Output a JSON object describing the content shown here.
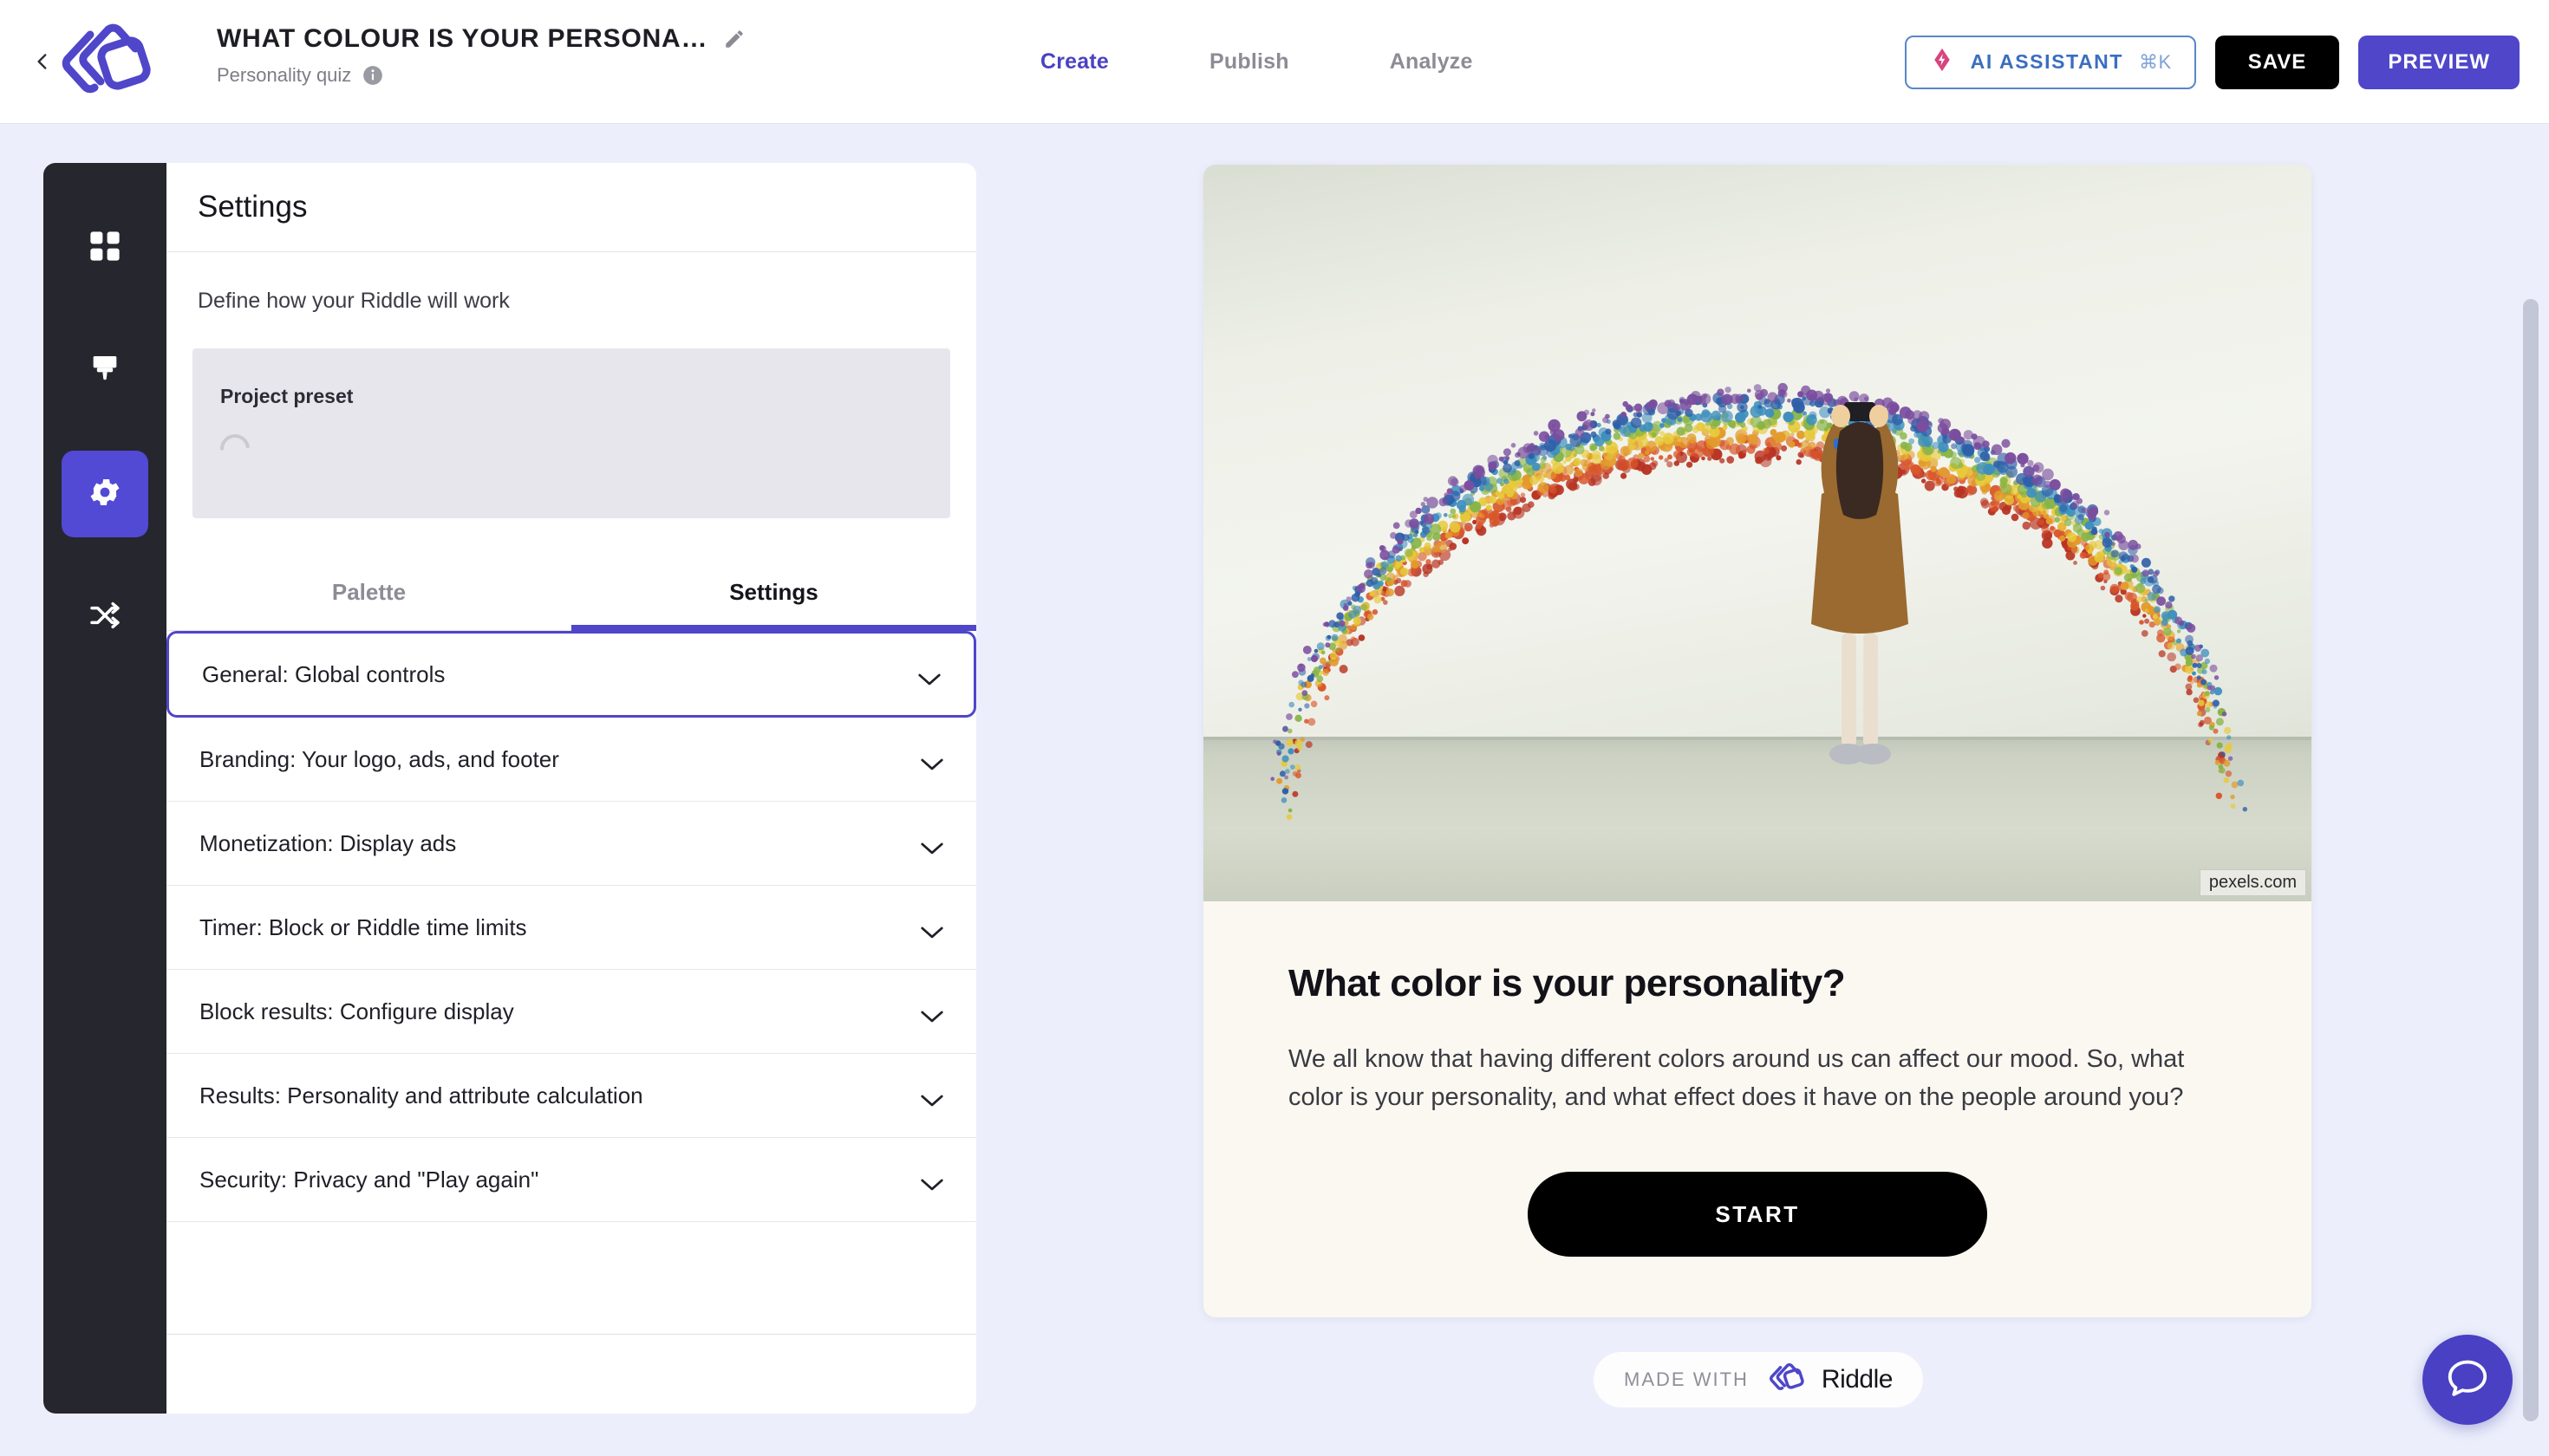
{
  "header": {
    "back_icon": "chevron-left-icon",
    "logo": "riddle-logo",
    "project_title": "WHAT COLOUR IS YOUR PERSONA…",
    "edit_icon": "pencil-icon",
    "project_subtitle": "Personality quiz",
    "info_icon": "info-icon",
    "nav": [
      {
        "label": "Create",
        "active": true
      },
      {
        "label": "Publish",
        "active": false
      },
      {
        "label": "Analyze",
        "active": false
      }
    ],
    "ai_assistant": {
      "label": "AI ASSISTANT",
      "shortcut": "⌘K",
      "icon": "ai-spark-icon",
      "border_color": "#5a86c9",
      "text_color": "#3a6ec0"
    },
    "save_label": "SAVE",
    "preview_label": "PREVIEW"
  },
  "rail": {
    "items": [
      {
        "name": "blocks",
        "icon": "grid-icon",
        "active": false
      },
      {
        "name": "design",
        "icon": "paintbrush-icon",
        "active": false
      },
      {
        "name": "settings",
        "icon": "gear-icon",
        "active": true
      },
      {
        "name": "share",
        "icon": "share-icon",
        "active": false
      }
    ],
    "active_color": "#5249d4",
    "background": "#26262e"
  },
  "settings": {
    "title": "Settings",
    "description": "Define how your Riddle will work",
    "preset": {
      "label": "Project preset",
      "state": "loading"
    },
    "tabs": [
      {
        "label": "Palette",
        "active": false
      },
      {
        "label": "Settings",
        "active": true
      }
    ],
    "accordion": [
      {
        "label": "General: Global controls",
        "focused": true
      },
      {
        "label": "Branding: Your logo, ads, and footer",
        "focused": false
      },
      {
        "label": "Monetization: Display ads",
        "focused": false
      },
      {
        "label": "Timer: Block or Riddle time limits",
        "focused": false
      },
      {
        "label": "Block results: Configure display",
        "focused": false
      },
      {
        "label": "Results: Personality and attribute calculation",
        "focused": false
      },
      {
        "label": "Security: Privacy and \"Play again\"",
        "focused": false
      }
    ],
    "accent_color": "#4f46c9"
  },
  "preview": {
    "image_alt": "woman-photographing-rainbow-wall-art",
    "image_credit": "pexels.com",
    "heading": "What color is your personality?",
    "body": "We all know that having different colors around us can affect our mood. So, what color is your personality, and what effect does it have on the people around you?",
    "start_label": "START"
  },
  "footer_badge": {
    "made_with": "MADE WITH",
    "brand": "Riddle",
    "logo": "riddle-logo"
  },
  "chat_widget": {
    "icon": "chat-bubble-icon",
    "color": "#4940c4"
  },
  "scrollbar": {
    "name": "page-scrollbar",
    "color": "#c3c6d6"
  }
}
